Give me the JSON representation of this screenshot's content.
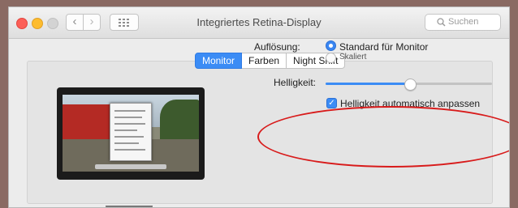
{
  "window": {
    "title": "Integriertes Retina-Display",
    "search_placeholder": "Suchen"
  },
  "nav": {
    "back": "‹",
    "forward": "›"
  },
  "tabs": [
    {
      "label": "Monitor",
      "active": true
    },
    {
      "label": "Farben",
      "active": false
    },
    {
      "label": "Night Shift",
      "active": false
    }
  ],
  "resolution": {
    "label": "Auflösung:",
    "options": [
      {
        "label": "Standard für Monitor",
        "selected": true
      },
      {
        "label": "Skaliert",
        "selected": false
      }
    ]
  },
  "brightness": {
    "label": "Helligkeit:",
    "value_fraction": 0.5,
    "auto_checked": true,
    "auto_label": "Helligkeit automatisch anpassen",
    "check_glyph": "✓"
  },
  "colors": {
    "accent": "#3b8cf5",
    "annotation": "#d81b1b"
  }
}
